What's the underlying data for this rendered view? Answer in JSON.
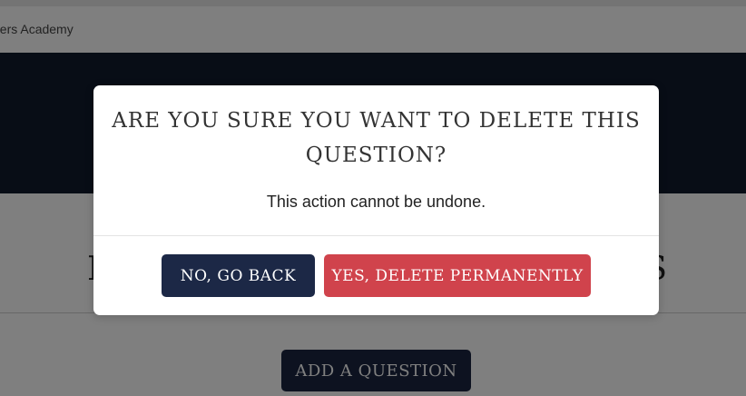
{
  "site": {
    "name": "ders Academy"
  },
  "page": {
    "heading_left": "F",
    "heading_right": "S",
    "add_button_label": "ADD A QUESTION"
  },
  "modal": {
    "title": "ARE YOU SURE YOU WANT TO DELETE THIS QUESTION?",
    "message": "This action cannot be undone.",
    "cancel_label": "NO, GO BACK",
    "confirm_label": "YES, DELETE PERMANENTLY"
  },
  "colors": {
    "hero_background": "#111a2d",
    "primary_button": "#1c2846",
    "danger_button": "#d0434c"
  }
}
